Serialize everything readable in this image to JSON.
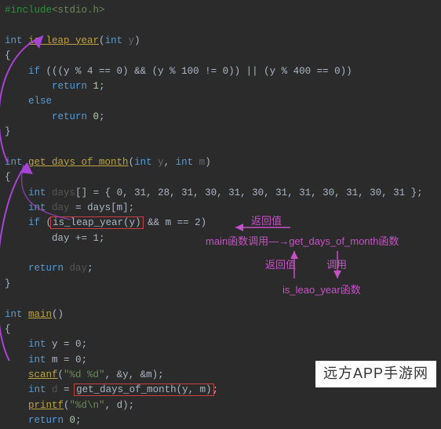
{
  "code": {
    "include_dir": "#include",
    "include_hdr": "<stdio.h>",
    "kw_int": "int",
    "kw_if": "if",
    "kw_else": "else",
    "kw_return": "return",
    "fn_is_leap": "is_leap_year",
    "fn_get_days": "get_days_of_month",
    "fn_main": "main",
    "fn_scanf": "scanf",
    "fn_printf": "printf",
    "param_y": "y",
    "param_m": "m",
    "var_days": "days",
    "var_day": "day",
    "var_d": "d",
    "leap_cond": "(((y % 4 == 0) && (y % 100 != 0)) || (y % 400 == 0))",
    "ret1": "1",
    "ret0": "0",
    "days_init": "{ 0, 31, 28, 31, 30, 31, 30, 31, 31, 30, 31, 30, 31 }",
    "day_assign": "days[m]",
    "leap_call": "is_leap_year(y)",
    "m_eq_2": "m == 2",
    "day_inc": "day += 1",
    "ret_day": "day",
    "y0": "y = 0",
    "m0": "m = 0",
    "scanf_fmt": "\"%d %d\"",
    "scanf_args": ", &y, &m",
    "gd_call": "get_days_of_month(y, m)",
    "printf_fmt": "\"%d\\n\"",
    "printf_args": ", d"
  },
  "annotations": {
    "return1": "返回值",
    "main_calls": "main函数调用",
    "arrow_to": "—→",
    "get_days_fn": "get_days_of_month函数",
    "return2": "返回值",
    "call": "调用",
    "is_leap_fn": "is_leao_year函数"
  },
  "watermark": "远方APP手游网"
}
